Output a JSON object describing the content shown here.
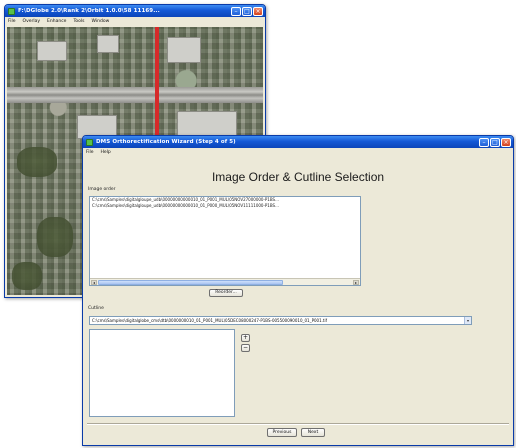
{
  "map_window": {
    "title": "F:\\DGlobe 2.0\\Rank 2\\Orbit 1.0.0\\58 11169...",
    "menu": [
      "File",
      "Overlay",
      "Enhance",
      "Tools",
      "Window"
    ]
  },
  "wizard_window": {
    "title": "DMS Orthorectification Wizard (Step 4 of 5)",
    "menu": [
      "File",
      "Help"
    ],
    "heading": "Image Order & Cutline Selection",
    "image_order_label": "Image order",
    "image_order_items": [
      "C:\\cms\\Samples\\digitalgloupe_udb\\00000000000010_01_P001_MUL\\05NOV27000000-P1BS...",
      "C:\\cms\\Samples\\digitalgloupe_udb\\00000000000010_01_P000_MUL\\05NOV11111000-P1BS..."
    ],
    "reorder_button": "Reorder...",
    "cutline_label": "Cutline",
    "cutline_value": "C:\\cms\\Samples\\digitalglobe_cms\\dtb\\0000000010_01_P001_MUL\\05DEC08000247-P1BS-005500090010_01_P001.tif",
    "add_symbol": "+",
    "remove_symbol": "−",
    "previous_button": "Previous",
    "next_button": "Next"
  }
}
